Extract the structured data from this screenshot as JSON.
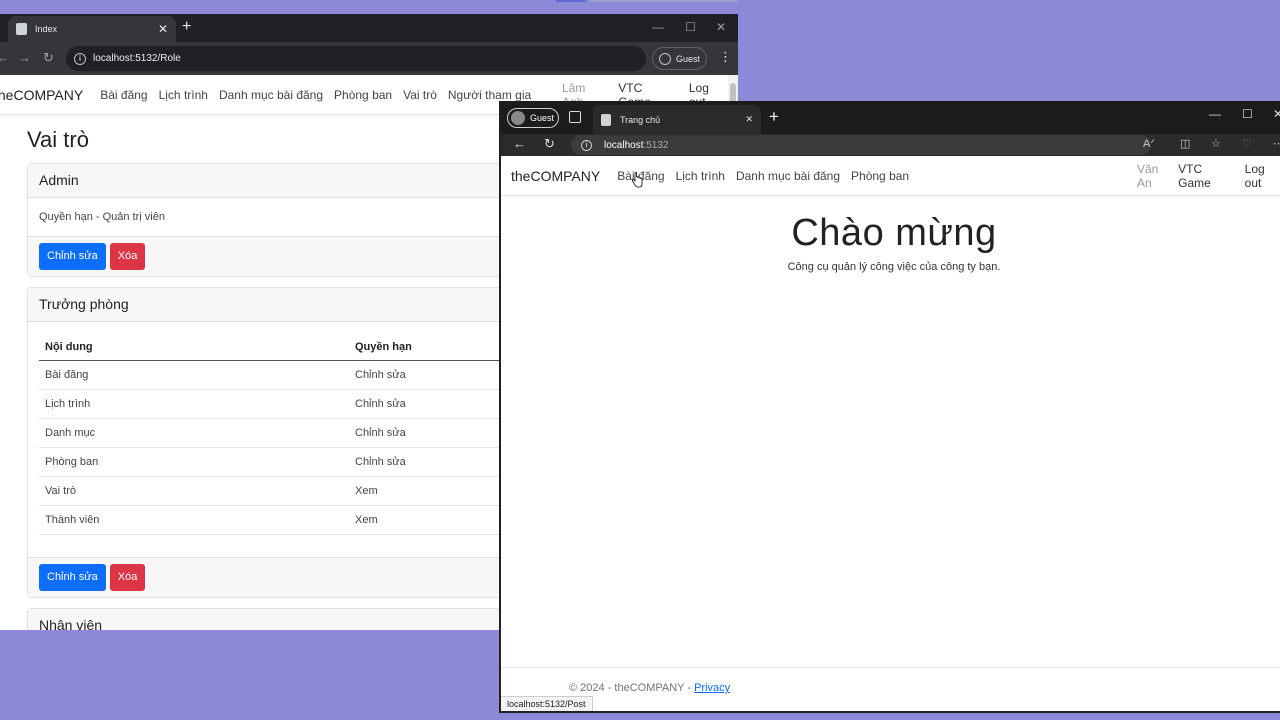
{
  "win1": {
    "tab_title": "Index",
    "tab_close": "✕",
    "new_tab": "+",
    "min": "—",
    "max": "☐",
    "close": "✕",
    "url": "localhost:5132/Role",
    "guest": "Guest",
    "menu": "⋮",
    "brand": "theCOMPANY",
    "nav": [
      "Bài đăng",
      "Lịch trình",
      "Danh mục bài đăng",
      "Phòng ban",
      "Vai trò",
      "Người tham gia"
    ],
    "user": "Lâm Anh",
    "org": "VTC Game",
    "logout": "Log out",
    "heading": "Vai trò",
    "cards": {
      "admin": {
        "title": "Admin",
        "body": "Quyền hạn - Quản trị viên",
        "edit": "Chỉnh sửa",
        "delete": "Xóa"
      },
      "manager": {
        "title": "Trưởng phòng",
        "columns": [
          "Nội dung",
          "Quyền hạn"
        ],
        "rows": [
          [
            "Bài đăng",
            "Chỉnh sửa"
          ],
          [
            "Lịch trình",
            "Chỉnh sửa"
          ],
          [
            "Danh mục",
            "Chỉnh sửa"
          ],
          [
            "Phòng ban",
            "Chỉnh sửa"
          ],
          [
            "Vai trò",
            "Xem"
          ],
          [
            "Thành viên",
            "Xem"
          ]
        ],
        "edit": "Chỉnh sửa",
        "delete": "Xóa"
      },
      "staff": {
        "title": "Nhân viên"
      }
    }
  },
  "win2": {
    "guest": "Guest",
    "tab_title": "Trang chủ",
    "tab_close": "✕",
    "new_tab": "+",
    "min": "—",
    "max": "☐",
    "close": "✕",
    "url_host": "localhost",
    "url_port": ":5132",
    "brand": "theCOMPANY",
    "nav": [
      "Bài đăng",
      "Lịch trình",
      "Danh mục bài đăng",
      "Phòng ban"
    ],
    "user": "Văn An",
    "org": "VTC Game",
    "logout": "Log out",
    "hero_title": "Chào mừng",
    "hero_subtitle": "Công cụ quản lý công việc của công ty bạn.",
    "footer_text": "© 2024 - theCOMPANY - ",
    "privacy": "Privacy",
    "status_url": "localhost:5132/Post"
  }
}
